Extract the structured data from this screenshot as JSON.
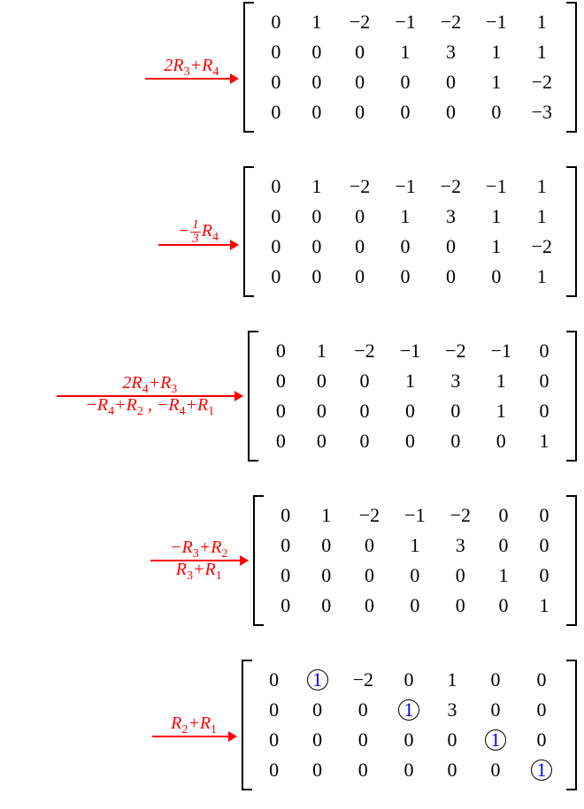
{
  "steps": [
    {
      "label_html": "2<i>R</i><sub>3</sub>+<i>R</i><sub>4</sub>",
      "sublabel_html": "",
      "arrow_width": 105,
      "matrix": [
        [
          "0",
          "1",
          "−2",
          "−1",
          "−2",
          "−1",
          "1"
        ],
        [
          "0",
          "0",
          "0",
          "1",
          "3",
          "1",
          "1"
        ],
        [
          "0",
          "0",
          "0",
          "0",
          "0",
          "1",
          "−2"
        ],
        [
          "0",
          "0",
          "0",
          "0",
          "0",
          "0",
          "−3"
        ]
      ],
      "circled": []
    },
    {
      "label_html": "−<span class='frac'><span class='num'>1</span><span class='den'>3</span></span><i>R</i><sub>4</sub>",
      "sublabel_html": "",
      "arrow_width": 90,
      "matrix": [
        [
          "0",
          "1",
          "−2",
          "−1",
          "−2",
          "−1",
          "1"
        ],
        [
          "0",
          "0",
          "0",
          "1",
          "3",
          "1",
          "1"
        ],
        [
          "0",
          "0",
          "0",
          "0",
          "0",
          "1",
          "−2"
        ],
        [
          "0",
          "0",
          "0",
          "0",
          "0",
          "0",
          "1"
        ]
      ],
      "circled": []
    },
    {
      "label_html": "2<i>R</i><sub>4</sub>+<i>R</i><sub>3</sub>",
      "sublabel_html": "−<i>R</i><sub>4</sub>+<i>R</i><sub>2</sub>&nbsp;,&nbsp;−<i>R</i><sub>4</sub>+<i>R</i><sub>1</sub>",
      "arrow_width": 210,
      "matrix": [
        [
          "0",
          "1",
          "−2",
          "−1",
          "−2",
          "−1",
          "0"
        ],
        [
          "0",
          "0",
          "0",
          "1",
          "3",
          "1",
          "0"
        ],
        [
          "0",
          "0",
          "0",
          "0",
          "0",
          "1",
          "0"
        ],
        [
          "0",
          "0",
          "0",
          "0",
          "0",
          "0",
          "1"
        ]
      ],
      "circled": []
    },
    {
      "label_html": "−<i>R</i><sub>3</sub>+<i>R</i><sub>2</sub>",
      "sublabel_html": "<i>R</i><sub>3</sub>+<i>R</i><sub>1</sub>",
      "arrow_width": 110,
      "matrix": [
        [
          "0",
          "1",
          "−2",
          "−1",
          "−2",
          "0",
          "0"
        ],
        [
          "0",
          "0",
          "0",
          "1",
          "3",
          "0",
          "0"
        ],
        [
          "0",
          "0",
          "0",
          "0",
          "0",
          "1",
          "0"
        ],
        [
          "0",
          "0",
          "0",
          "0",
          "0",
          "0",
          "1"
        ]
      ],
      "circled": []
    },
    {
      "label_html": "<i>R</i><sub>2</sub>+<i>R</i><sub>1</sub>",
      "sublabel_html": "",
      "arrow_width": 95,
      "matrix": [
        [
          "0",
          "1",
          "−2",
          "0",
          "1",
          "0",
          "0"
        ],
        [
          "0",
          "0",
          "0",
          "1",
          "3",
          "0",
          "0"
        ],
        [
          "0",
          "0",
          "0",
          "0",
          "0",
          "1",
          "0"
        ],
        [
          "0",
          "0",
          "0",
          "0",
          "0",
          "0",
          "1"
        ]
      ],
      "circled": [
        [
          0,
          1
        ],
        [
          1,
          3
        ],
        [
          2,
          5
        ],
        [
          3,
          6
        ]
      ]
    }
  ]
}
